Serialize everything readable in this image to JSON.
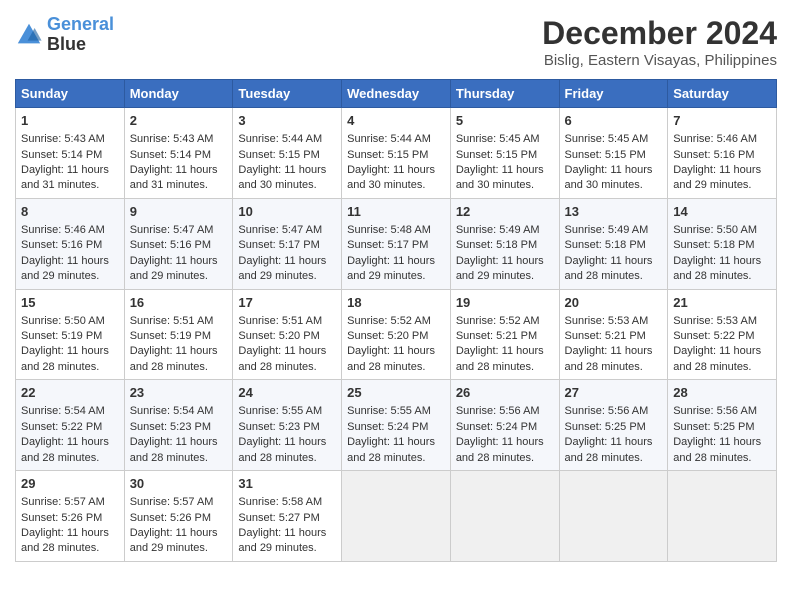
{
  "logo": {
    "line1": "General",
    "line2": "Blue"
  },
  "title": "December 2024",
  "subtitle": "Bislig, Eastern Visayas, Philippines",
  "days_of_week": [
    "Sunday",
    "Monday",
    "Tuesday",
    "Wednesday",
    "Thursday",
    "Friday",
    "Saturday"
  ],
  "weeks": [
    [
      {
        "day": "1",
        "sunrise": "5:43 AM",
        "sunset": "5:14 PM",
        "daylight": "11 hours and 31 minutes."
      },
      {
        "day": "2",
        "sunrise": "5:43 AM",
        "sunset": "5:14 PM",
        "daylight": "11 hours and 31 minutes."
      },
      {
        "day": "3",
        "sunrise": "5:44 AM",
        "sunset": "5:15 PM",
        "daylight": "11 hours and 30 minutes."
      },
      {
        "day": "4",
        "sunrise": "5:44 AM",
        "sunset": "5:15 PM",
        "daylight": "11 hours and 30 minutes."
      },
      {
        "day": "5",
        "sunrise": "5:45 AM",
        "sunset": "5:15 PM",
        "daylight": "11 hours and 30 minutes."
      },
      {
        "day": "6",
        "sunrise": "5:45 AM",
        "sunset": "5:15 PM",
        "daylight": "11 hours and 30 minutes."
      },
      {
        "day": "7",
        "sunrise": "5:46 AM",
        "sunset": "5:16 PM",
        "daylight": "11 hours and 29 minutes."
      }
    ],
    [
      {
        "day": "8",
        "sunrise": "5:46 AM",
        "sunset": "5:16 PM",
        "daylight": "11 hours and 29 minutes."
      },
      {
        "day": "9",
        "sunrise": "5:47 AM",
        "sunset": "5:16 PM",
        "daylight": "11 hours and 29 minutes."
      },
      {
        "day": "10",
        "sunrise": "5:47 AM",
        "sunset": "5:17 PM",
        "daylight": "11 hours and 29 minutes."
      },
      {
        "day": "11",
        "sunrise": "5:48 AM",
        "sunset": "5:17 PM",
        "daylight": "11 hours and 29 minutes."
      },
      {
        "day": "12",
        "sunrise": "5:49 AM",
        "sunset": "5:18 PM",
        "daylight": "11 hours and 29 minutes."
      },
      {
        "day": "13",
        "sunrise": "5:49 AM",
        "sunset": "5:18 PM",
        "daylight": "11 hours and 28 minutes."
      },
      {
        "day": "14",
        "sunrise": "5:50 AM",
        "sunset": "5:18 PM",
        "daylight": "11 hours and 28 minutes."
      }
    ],
    [
      {
        "day": "15",
        "sunrise": "5:50 AM",
        "sunset": "5:19 PM",
        "daylight": "11 hours and 28 minutes."
      },
      {
        "day": "16",
        "sunrise": "5:51 AM",
        "sunset": "5:19 PM",
        "daylight": "11 hours and 28 minutes."
      },
      {
        "day": "17",
        "sunrise": "5:51 AM",
        "sunset": "5:20 PM",
        "daylight": "11 hours and 28 minutes."
      },
      {
        "day": "18",
        "sunrise": "5:52 AM",
        "sunset": "5:20 PM",
        "daylight": "11 hours and 28 minutes."
      },
      {
        "day": "19",
        "sunrise": "5:52 AM",
        "sunset": "5:21 PM",
        "daylight": "11 hours and 28 minutes."
      },
      {
        "day": "20",
        "sunrise": "5:53 AM",
        "sunset": "5:21 PM",
        "daylight": "11 hours and 28 minutes."
      },
      {
        "day": "21",
        "sunrise": "5:53 AM",
        "sunset": "5:22 PM",
        "daylight": "11 hours and 28 minutes."
      }
    ],
    [
      {
        "day": "22",
        "sunrise": "5:54 AM",
        "sunset": "5:22 PM",
        "daylight": "11 hours and 28 minutes."
      },
      {
        "day": "23",
        "sunrise": "5:54 AM",
        "sunset": "5:23 PM",
        "daylight": "11 hours and 28 minutes."
      },
      {
        "day": "24",
        "sunrise": "5:55 AM",
        "sunset": "5:23 PM",
        "daylight": "11 hours and 28 minutes."
      },
      {
        "day": "25",
        "sunrise": "5:55 AM",
        "sunset": "5:24 PM",
        "daylight": "11 hours and 28 minutes."
      },
      {
        "day": "26",
        "sunrise": "5:56 AM",
        "sunset": "5:24 PM",
        "daylight": "11 hours and 28 minutes."
      },
      {
        "day": "27",
        "sunrise": "5:56 AM",
        "sunset": "5:25 PM",
        "daylight": "11 hours and 28 minutes."
      },
      {
        "day": "28",
        "sunrise": "5:56 AM",
        "sunset": "5:25 PM",
        "daylight": "11 hours and 28 minutes."
      }
    ],
    [
      {
        "day": "29",
        "sunrise": "5:57 AM",
        "sunset": "5:26 PM",
        "daylight": "11 hours and 28 minutes."
      },
      {
        "day": "30",
        "sunrise": "5:57 AM",
        "sunset": "5:26 PM",
        "daylight": "11 hours and 29 minutes."
      },
      {
        "day": "31",
        "sunrise": "5:58 AM",
        "sunset": "5:27 PM",
        "daylight": "11 hours and 29 minutes."
      },
      null,
      null,
      null,
      null
    ]
  ]
}
